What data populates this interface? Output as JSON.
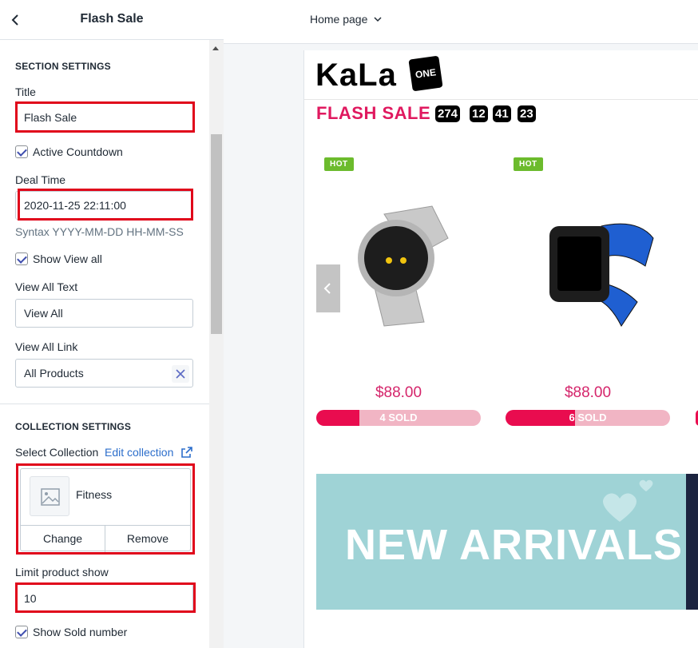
{
  "sidebar": {
    "title": "Flash Sale",
    "section_settings": {
      "heading": "SECTION SETTINGS",
      "title_label": "Title",
      "title_value": "Flash Sale",
      "active_countdown_label": "Active Countdown",
      "active_countdown_checked": true,
      "deal_time_label": "Deal Time",
      "deal_time_value": "2020-11-25 22:11:00",
      "deal_time_help": "Syntax YYYY-MM-DD HH-MM-SS",
      "show_view_all_label": "Show View all",
      "show_view_all_checked": true,
      "view_all_text_label": "View All Text",
      "view_all_text_value": "View All",
      "view_all_link_label": "View All Link",
      "view_all_link_value": "All Products"
    },
    "collection_settings": {
      "heading": "COLLECTION SETTINGS",
      "select_collection_label": "Select Collection",
      "edit_collection_link": "Edit collection",
      "collection_name": "Fitness",
      "change_label": "Change",
      "remove_label": "Remove",
      "limit_label": "Limit product show",
      "limit_value": "10",
      "show_sold_label": "Show Sold number",
      "show_sold_checked": true
    }
  },
  "topbar": {
    "page_select": "Home page"
  },
  "preview": {
    "logo_text": "KaLa",
    "logo_badge": "ONE",
    "flash_title": "FLASH SALE",
    "countdown": [
      "274",
      "12",
      "41",
      "23"
    ],
    "products": [
      {
        "badge": "HOT",
        "price": "$88.00",
        "sold": "4 SOLD",
        "sold_fraction": 0.26
      },
      {
        "badge": "HOT",
        "price": "$88.00",
        "sold": "6 SOLD",
        "sold_fraction": 0.42
      }
    ],
    "banner_text": "NEW ARRIVALS"
  },
  "colors": {
    "highlight_red": "#e0061b",
    "brand_pink": "#e0195f",
    "hot_green": "#6cbb2d",
    "banner_teal": "#9fd3d6",
    "link_blue": "#2c6ecb"
  }
}
